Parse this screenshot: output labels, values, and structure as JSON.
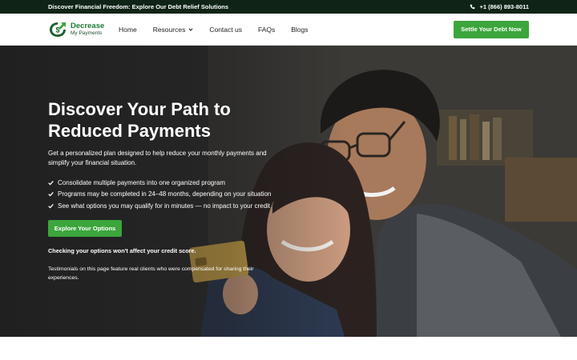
{
  "topbar": {
    "promo": "Discover Financial Freedom: Explore Our Debt Relief Solutions",
    "phone": "+1 (866) 893-8011"
  },
  "brand": {
    "line1": "Decrease",
    "line2": "My Payments",
    "accent": "#3ca53c"
  },
  "nav": {
    "items": [
      {
        "label": "Home"
      },
      {
        "label": "Resources",
        "icon": "chevron-down-icon"
      },
      {
        "label": "Contact us"
      },
      {
        "label": "FAQs"
      },
      {
        "label": "Blogs"
      }
    ],
    "cta": "Settle Your Debt Now"
  },
  "hero": {
    "title": "Discover Your Path to Reduced Payments",
    "subtitle": "Get a personalized plan designed to help reduce your monthly payments and simplify your financial situation.",
    "bullets": [
      "Consolidate multiple payments into one organized program",
      "Programs may be completed in 24–48 months, depending on your situation",
      "See what options you may qualify for in minutes — no impact to your credit"
    ],
    "cta": "Explore Your Options",
    "note": "Checking your options won't affect your credit score.",
    "disclaimer": "Testimonials on this page feature real clients who were compensated for sharing their experiences."
  }
}
